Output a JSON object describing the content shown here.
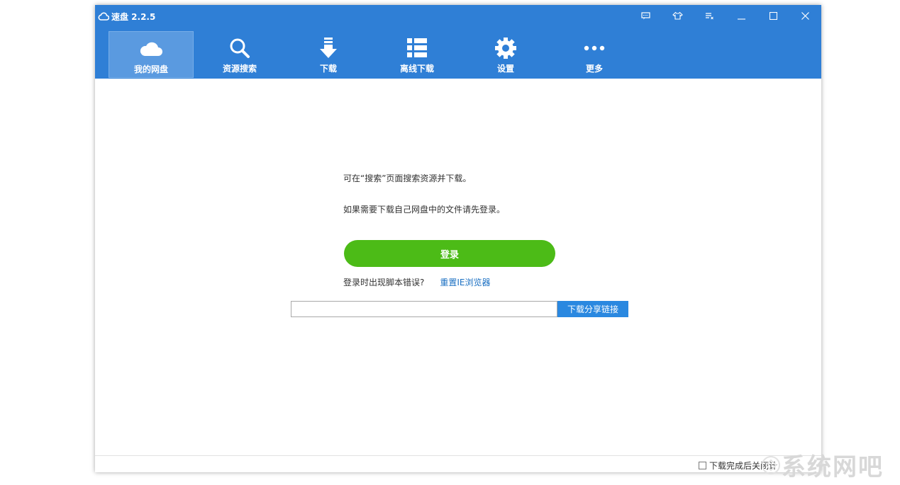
{
  "app": {
    "title": "速盘 2.2.5"
  },
  "window_controls": [
    {
      "name": "message-icon"
    },
    {
      "name": "skin-icon"
    },
    {
      "name": "menu-icon"
    },
    {
      "name": "minimize-icon"
    },
    {
      "name": "maximize-icon"
    },
    {
      "name": "close-icon"
    }
  ],
  "nav": {
    "items": [
      {
        "label": "我的网盘",
        "icon": "cloud-icon",
        "active": true
      },
      {
        "label": "资源搜索",
        "icon": "search-icon"
      },
      {
        "label": "下载",
        "icon": "download-arrow-icon"
      },
      {
        "label": "离线下载",
        "icon": "list-icon"
      },
      {
        "label": "设置",
        "icon": "gear-icon"
      },
      {
        "label": "更多",
        "icon": "more-dots-icon"
      }
    ]
  },
  "main": {
    "hint_search": "可在“搜索”页面搜索资源并下载。",
    "hint_login": "如果需要下载自己网盘中的文件请先登录。",
    "login_button": "登录",
    "script_error_text": "登录时出现脚本错误?",
    "reset_ie_link": "重置IE浏览器",
    "share_input_value": "",
    "share_button": "下载分享链接"
  },
  "status_bar": {
    "close_after_download_label": "下载完成后关闭计",
    "close_after_download_checked": false
  },
  "watermark": {
    "text": "系统网吧"
  },
  "colors": {
    "header": "#2f7fd6",
    "nav_active": "#5a9ae0",
    "login_green": "#4cbb17",
    "share_button_blue": "#2a88e0",
    "link_blue": "#1a6fc2"
  }
}
